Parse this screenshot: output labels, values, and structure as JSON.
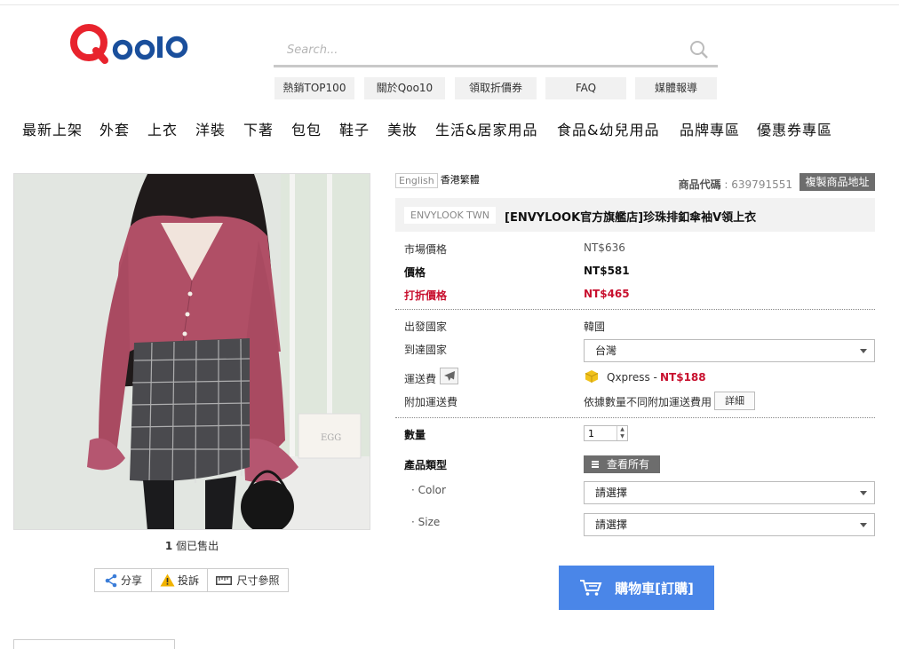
{
  "header": {
    "search_placeholder": "Search...",
    "quick_links": [
      "熱銷TOP100",
      "關於Qoo10",
      "領取折價券",
      "FAQ",
      "媒體報導"
    ],
    "categories": [
      "最新上架",
      "外套",
      "上衣",
      "洋裝",
      "下著",
      "包包",
      "鞋子",
      "美妝",
      "生活&居家用品",
      "食品&幼兒用品",
      "品牌專區",
      "優惠券專區"
    ]
  },
  "logo": {
    "text": "Qoo10",
    "accent": "#e8232d",
    "blue": "#1a4f9c"
  },
  "gallery": {
    "sold_count": "1",
    "sold_suffix": " 個已售出",
    "share_label": "分享",
    "report_label": "投訴",
    "size_label": "尺寸參照"
  },
  "product": {
    "lang_en": "English",
    "lang_tw": "香港繁體",
    "code_label": "商品代碼",
    "code_value": " : 639791551",
    "copy_url_label": "複製商品地址",
    "brand": "ENVYLOOK TWN",
    "title": "[ENVYLOOK官方旗艦店]珍珠排釦傘袖V領上衣",
    "market_price_label": "市場價格",
    "market_price": "NT$636",
    "price_label": "價格",
    "price": "NT$581",
    "discount_label": "打折價格",
    "discount_price": "NT$465",
    "origin_label": "出發國家",
    "origin": "韓國",
    "dest_label": "到達國家",
    "dest": "台灣",
    "shipping_label": "運送費",
    "shipping_method": "Qxpress - ",
    "shipping_fee": "NT$188",
    "extra_fee_label": "附加運送費",
    "extra_fee_text": "依據數量不同附加運送費用",
    "detail_label": "詳細",
    "qty_label": "數量",
    "qty_value": "1",
    "option_label": "產品類型",
    "view_all_label": "查看所有",
    "color_label": "· Color",
    "color_value": "請選擇",
    "size_label": "· Size",
    "size_value": "請選擇",
    "cart_label": "購物車[訂購]"
  },
  "colors": {
    "red": "#c8102e",
    "cart_blue": "#4a86e8",
    "gray_btn": "#6d6d6d"
  }
}
